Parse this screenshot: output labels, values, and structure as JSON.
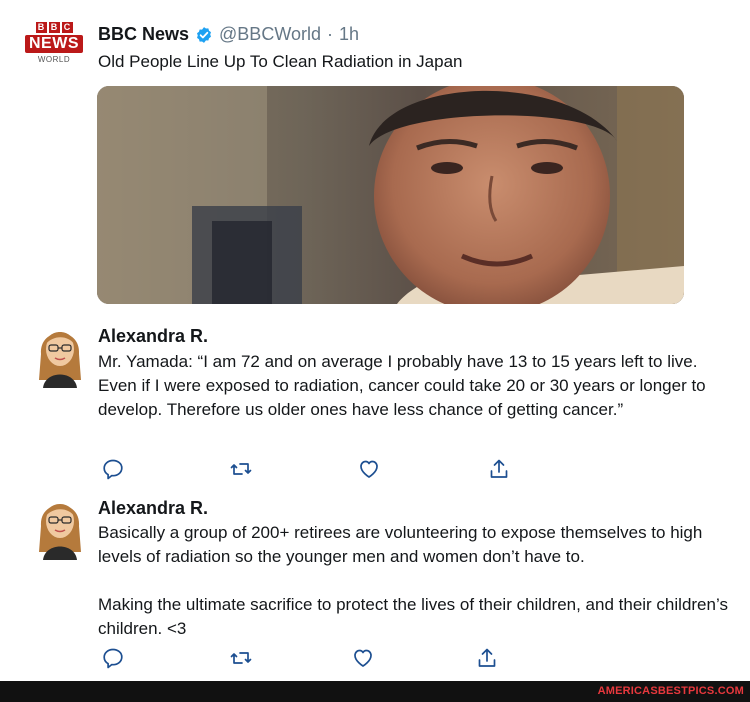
{
  "tweet": {
    "logo_top": "BBC",
    "logo_middle": "NEWS",
    "logo_bottom": "WORLD",
    "author_name": "BBC News",
    "handle": "@BBCWorld",
    "separator": "·",
    "time": "1h",
    "text": "Old People Line Up To Clean Radiation in Japan"
  },
  "replies": [
    {
      "author_name": "Alexandra R.",
      "paragraphs": [
        "Mr. Yamada: “I am 72 and on average I probably have 13 to 15 years left to live. Even if I were exposed to radiation, cancer could take 20 or 30 years or longer to develop. Therefore us older ones have less chance of getting cancer.”"
      ]
    },
    {
      "author_name": "Alexandra R.",
      "paragraphs": [
        "Basically a group of 200+ retirees are volunteering to expose themselves to high levels of radiation so the younger men and women don’t have to.",
        "Making the ultimate sacrifice to protect the lives of their children, and their children’s children. <3"
      ]
    }
  ],
  "actions": {
    "icons": [
      "reply-icon",
      "retweet-icon",
      "like-icon",
      "share-icon"
    ]
  },
  "footer": {
    "watermark": "AMERICASBESTPICS.COM"
  },
  "colors": {
    "bbc_red": "#bb1919",
    "verified_blue": "#1da1f2",
    "action_blue": "#1d4f91",
    "muted": "#657786",
    "watermark_red": "#e8383d"
  }
}
